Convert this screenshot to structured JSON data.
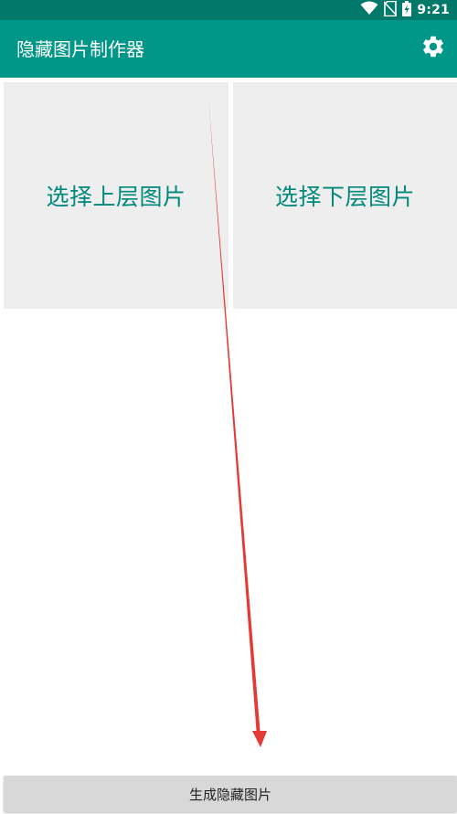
{
  "status_bar": {
    "time": "9:21",
    "icons": [
      "wifi-icon",
      "no-sim-icon",
      "battery-charging-icon"
    ]
  },
  "app_bar": {
    "title": "隐藏图片制作器",
    "action_icon": "gear-icon"
  },
  "pickers": {
    "top_layer_label": "选择上层图片",
    "bottom_layer_label": "选择下层图片"
  },
  "generate_button": {
    "label": "生成隐藏图片"
  },
  "colors": {
    "status_bar": "#00796b",
    "app_bar": "#009688",
    "accent_text": "#00897b",
    "picker_bg": "#eeeeee",
    "button_bg": "#d8d8d8",
    "annotation_arrow": "#e53935"
  }
}
